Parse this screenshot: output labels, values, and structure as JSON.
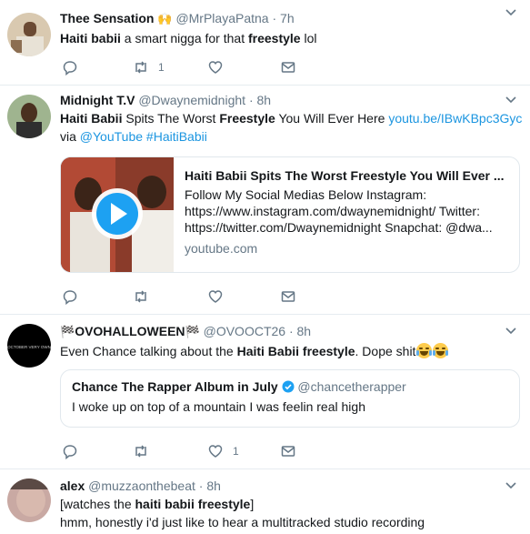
{
  "tweets": [
    {
      "name": "Thee Sensation",
      "name_emoji": "🙌",
      "handle": "@MrPlayaPatna",
      "time": "7h",
      "body": {
        "bold1": "Haiti babii",
        "t1": " a smart nigga for that ",
        "bold2": "freestyle",
        "t2": " lol"
      },
      "actions": {
        "reply": "",
        "retweet": "1",
        "like": "",
        "dm": ""
      }
    },
    {
      "name": "Midnight T.V",
      "handle": "@Dwaynemidnight",
      "time": "8h",
      "body": {
        "bold1": "Haiti Babii",
        "t1": " Spits The Worst ",
        "bold2": "Freestyle",
        "t2": " You Will Ever Here ",
        "link": "youtu.be/IBwKBpc3Gyc",
        "line2_pre": "via ",
        "mention": "@YouTube",
        "hashtag": "#HaitiBabii"
      },
      "card": {
        "title": "Haiti Babii Spits The Worst Freestyle You Will Ever ...",
        "desc1": "Follow My Social Medias Below Instagram:",
        "desc2": "https://www.instagram.com/dwaynemidnight/ Twitter:",
        "desc3": "https://twitter.com/Dwaynemidnight Snapchat: @dwa...",
        "domain": "youtube.com"
      },
      "actions": {
        "reply": "",
        "retweet": "",
        "like": "",
        "dm": ""
      }
    },
    {
      "name": "OVOHALLOWEEN",
      "name_prefix": "🏁",
      "name_suffix": "🏁",
      "handle": "@OVOOCT26",
      "time": "8h",
      "body": {
        "t0": "Even Chance talking about the ",
        "bold1": "Haiti Babii freestyle",
        "t1": ". Dope shit"
      },
      "quote": {
        "name": "Chance The Rapper Album in July",
        "handle": "@chancetherapper",
        "text": "I woke up on top of a mountain I was feelin real high"
      },
      "actions": {
        "reply": "",
        "retweet": "",
        "like": "1",
        "dm": ""
      }
    },
    {
      "name": "alex",
      "handle": "@muzzaonthebeat",
      "time": "8h",
      "body": {
        "t0": "[watches the ",
        "bold1": "haiti babii freestyle",
        "t1": "]",
        "line2": "hmm, honestly i'd just like to hear a multitracked studio recording"
      }
    }
  ],
  "colors": {
    "link": "#1b95e0",
    "secondary": "#657786",
    "verified": "#1da1f2",
    "border": "#e1e8ed"
  }
}
